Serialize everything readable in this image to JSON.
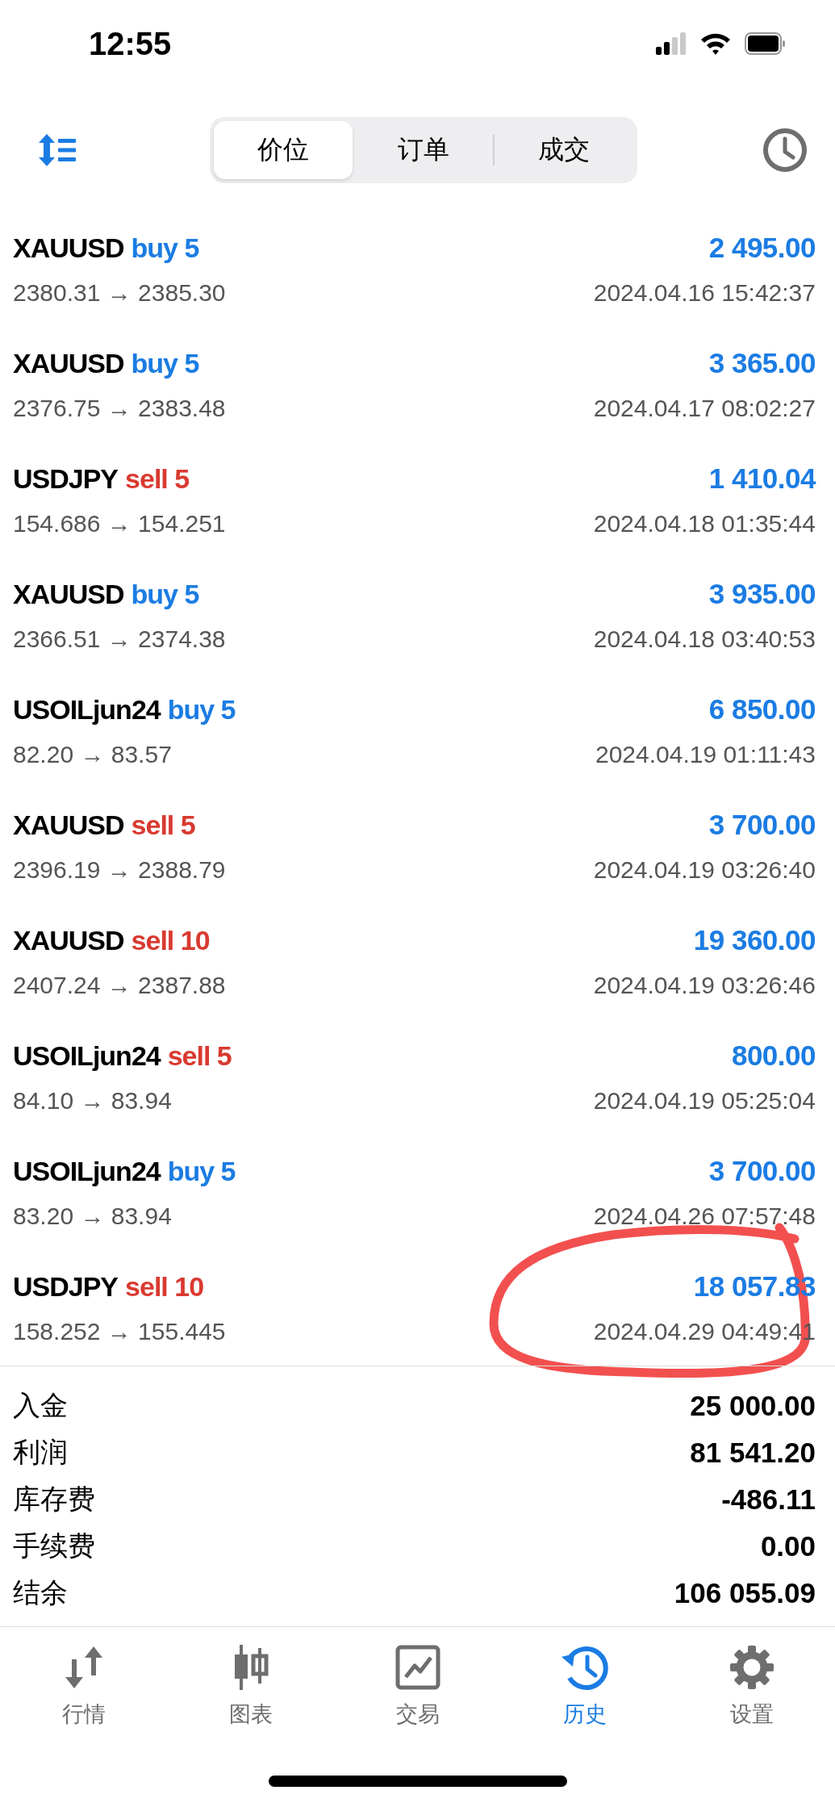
{
  "status_bar": {
    "time": "12:55"
  },
  "segments": [
    {
      "label": "价位",
      "selected": true
    },
    {
      "label": "订单",
      "selected": false
    },
    {
      "label": "成交",
      "selected": false
    }
  ],
  "trades": [
    {
      "symbol": "XAUUSD",
      "order": "buy 5",
      "kind": "buy",
      "prices": "2380.31 → 2385.30",
      "profit": "2 495.00",
      "time": "2024.04.16 15:42:37"
    },
    {
      "symbol": "XAUUSD",
      "order": "buy 5",
      "kind": "buy",
      "prices": "2376.75 → 2383.48",
      "profit": "3 365.00",
      "time": "2024.04.17 08:02:27"
    },
    {
      "symbol": "USDJPY",
      "order": "sell 5",
      "kind": "sell",
      "prices": "154.686 → 154.251",
      "profit": "1 410.04",
      "time": "2024.04.18 01:35:44"
    },
    {
      "symbol": "XAUUSD",
      "order": "buy 5",
      "kind": "buy",
      "prices": "2366.51 → 2374.38",
      "profit": "3 935.00",
      "time": "2024.04.18 03:40:53"
    },
    {
      "symbol": "USOILjun24",
      "order": "buy 5",
      "kind": "buy",
      "prices": "82.20 → 83.57",
      "profit": "6 850.00",
      "time": "2024.04.19 01:11:43"
    },
    {
      "symbol": "XAUUSD",
      "order": "sell 5",
      "kind": "sell",
      "prices": "2396.19 → 2388.79",
      "profit": "3 700.00",
      "time": "2024.04.19 03:26:40"
    },
    {
      "symbol": "XAUUSD",
      "order": "sell 10",
      "kind": "sell",
      "prices": "2407.24 → 2387.88",
      "profit": "19 360.00",
      "time": "2024.04.19 03:26:46"
    },
    {
      "symbol": "USOILjun24",
      "order": "sell 5",
      "kind": "sell",
      "prices": "84.10 → 83.94",
      "profit": "800.00",
      "time": "2024.04.19 05:25:04"
    },
    {
      "symbol": "USOILjun24",
      "order": "buy 5",
      "kind": "buy",
      "prices": "83.20 → 83.94",
      "profit": "3 700.00",
      "time": "2024.04.26 07:57:48"
    },
    {
      "symbol": "USDJPY",
      "order": "sell 10",
      "kind": "sell",
      "prices": "158.252 → 155.445",
      "profit": "18 057.83",
      "time": "2024.04.29 04:49:41"
    }
  ],
  "summary": [
    {
      "label": "入金",
      "value": "25 000.00"
    },
    {
      "label": "利润",
      "value": "81 541.20"
    },
    {
      "label": "库存费",
      "value": "-486.11"
    },
    {
      "label": "手续费",
      "value": "0.00"
    },
    {
      "label": "结余",
      "value": "106 055.09"
    }
  ],
  "tabs": [
    {
      "label": "行情",
      "kind": "quotes",
      "selected": false
    },
    {
      "label": "图表",
      "kind": "chart",
      "selected": false
    },
    {
      "label": "交易",
      "kind": "trade",
      "selected": false
    },
    {
      "label": "历史",
      "kind": "history",
      "selected": true
    },
    {
      "label": "设置",
      "kind": "settings",
      "selected": false
    }
  ],
  "annotation": {
    "kind": "circle"
  }
}
